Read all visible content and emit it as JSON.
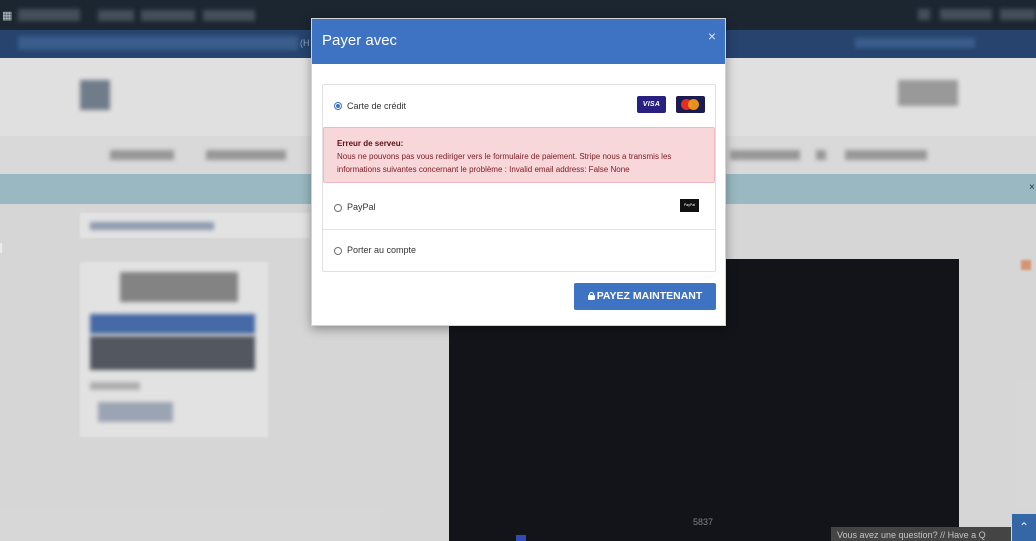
{
  "background": {
    "page_number_text": "5837",
    "chat_prompt": "Vous avez une question? // Have a Q",
    "side_close": "×",
    "partial_hint": "(H"
  },
  "modal": {
    "title": "Payer avec",
    "close_glyph": "×",
    "options": {
      "credit_card": {
        "label": "Carte de crédit",
        "selected": true,
        "logos": [
          "VISA",
          "MasterCard"
        ]
      },
      "paypal": {
        "label": "PayPal",
        "selected": false,
        "logo": "PayPal"
      },
      "account": {
        "label": "Porter au compte",
        "selected": false
      }
    },
    "error": {
      "title": "Erreur de serveu:",
      "message": "Nous ne pouvons pas vous rediriger vers le formulaire de paiement. Stripe nous a transmis les informations suivantes concernant le problème : Invalid email address: False None"
    },
    "pay_button": "PAYEZ MAINTENANT",
    "colors": {
      "primary": "#3e72c2",
      "error_bg": "#f8d7da",
      "error_text": "#7a1b22"
    }
  }
}
